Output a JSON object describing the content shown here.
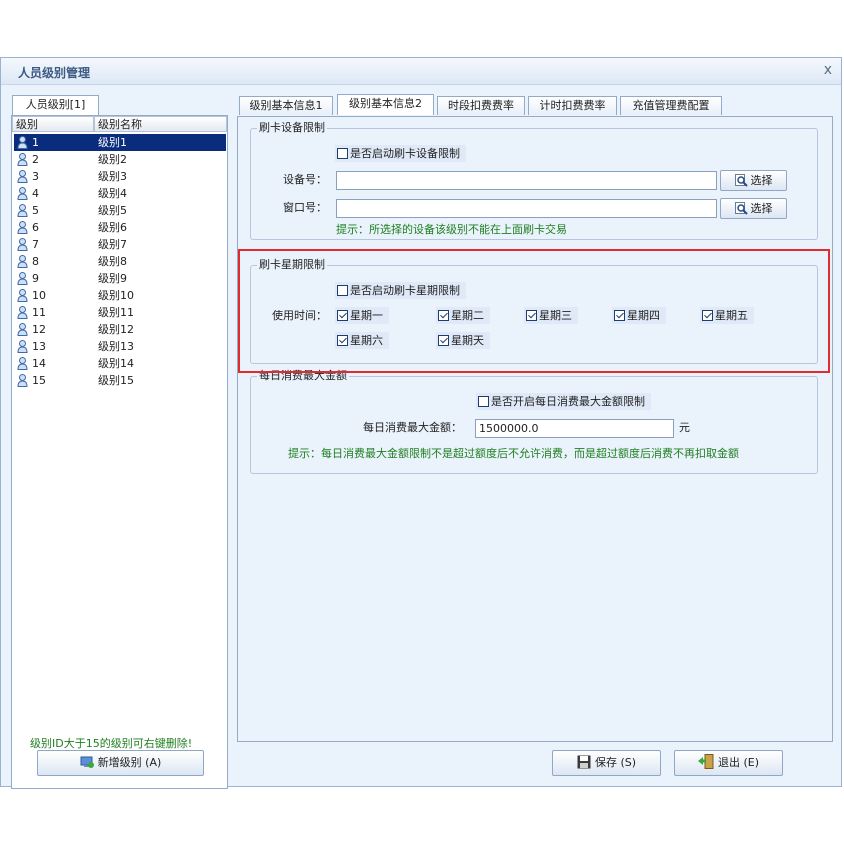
{
  "window": {
    "title": "人员级别管理",
    "close_glyph": "x"
  },
  "left_tab": "人员级别[1]",
  "level_list": {
    "headers": [
      "级别",
      "级别名称"
    ],
    "rows": [
      {
        "id": "1",
        "name": "级别1"
      },
      {
        "id": "2",
        "name": "级别2"
      },
      {
        "id": "3",
        "name": "级别3"
      },
      {
        "id": "4",
        "name": "级别4"
      },
      {
        "id": "5",
        "name": "级别5"
      },
      {
        "id": "6",
        "name": "级别6"
      },
      {
        "id": "7",
        "name": "级别7"
      },
      {
        "id": "8",
        "name": "级别8"
      },
      {
        "id": "9",
        "name": "级别9"
      },
      {
        "id": "10",
        "name": "级别10"
      },
      {
        "id": "11",
        "name": "级别11"
      },
      {
        "id": "12",
        "name": "级别12"
      },
      {
        "id": "13",
        "name": "级别13"
      },
      {
        "id": "14",
        "name": "级别14"
      },
      {
        "id": "15",
        "name": "级别15"
      }
    ],
    "selected_index": 0
  },
  "left_hint": "级别ID大于15的级别可右键删除!",
  "add_level_button": "新增级别 (A)",
  "tabs": [
    "级别基本信息1",
    "级别基本信息2",
    "时段扣费费率",
    "计时扣费费率",
    "充值管理费配置"
  ],
  "active_tab": 1,
  "device_group": {
    "legend": "刷卡设备限制",
    "enable_label": "是否启动刷卡设备限制",
    "enable_checked": false,
    "device_label": "设备号：",
    "device_value": "",
    "window_label": "窗口号：",
    "window_value": "",
    "select_label": "选择",
    "hint": "提示：所选择的设备该级别不能在上面刷卡交易"
  },
  "weekday_group": {
    "legend": "刷卡星期限制",
    "enable_label": "是否启动刷卡星期限制",
    "enable_checked": false,
    "use_time_label": "使用时间：",
    "days": [
      {
        "label": "星期一",
        "checked": true
      },
      {
        "label": "星期二",
        "checked": true
      },
      {
        "label": "星期三",
        "checked": true
      },
      {
        "label": "星期四",
        "checked": true
      },
      {
        "label": "星期五",
        "checked": true
      },
      {
        "label": "星期六",
        "checked": true
      },
      {
        "label": "星期天",
        "checked": true
      }
    ]
  },
  "daily_group": {
    "legend": "每日消费最大金额",
    "enable_label": "是否开启每日消费最大金额限制",
    "enable_checked": false,
    "amount_label": "每日消费最大金额：",
    "amount_value": "1500000.0",
    "unit": "元",
    "hint": "提示：每日消费最大金额限制不是超过额度后不允许消费，而是超过额度后消费不再扣取金额"
  },
  "save_button": "保存 (S)",
  "exit_button": "退出 (E)",
  "colors": {
    "selection": "#0a2c7c",
    "hint_green": "#1f7f1f",
    "highlight_red": "#e02c2c",
    "panel": "#eaf2fc"
  }
}
